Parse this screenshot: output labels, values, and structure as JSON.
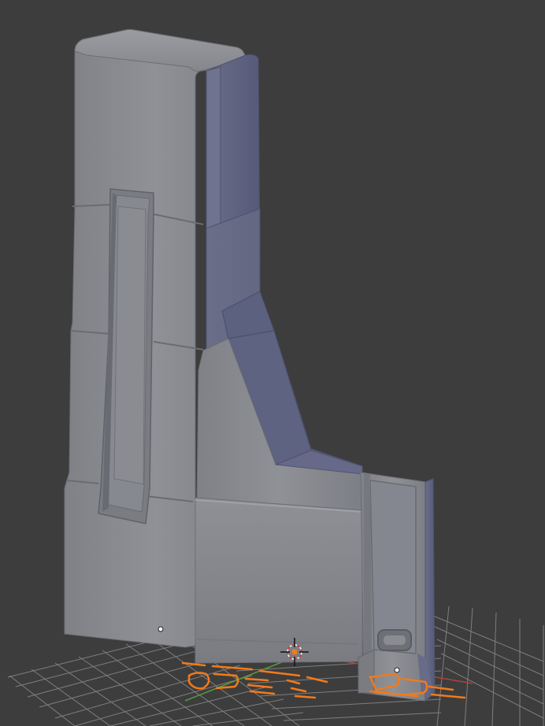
{
  "viewport": {
    "background_color": "#3d3d3d",
    "grid_color": "#8a8a8a",
    "axis_x_color": "#b04040",
    "axis_y_color": "#5a9a3a",
    "mesh_light_color": "#8d8f94",
    "mesh_shadow_color": "#5e6280",
    "selection_outline_color": "#f27a1b",
    "origin_point_color": "#ffffff",
    "cursor_icon": "3d-cursor-icon"
  }
}
